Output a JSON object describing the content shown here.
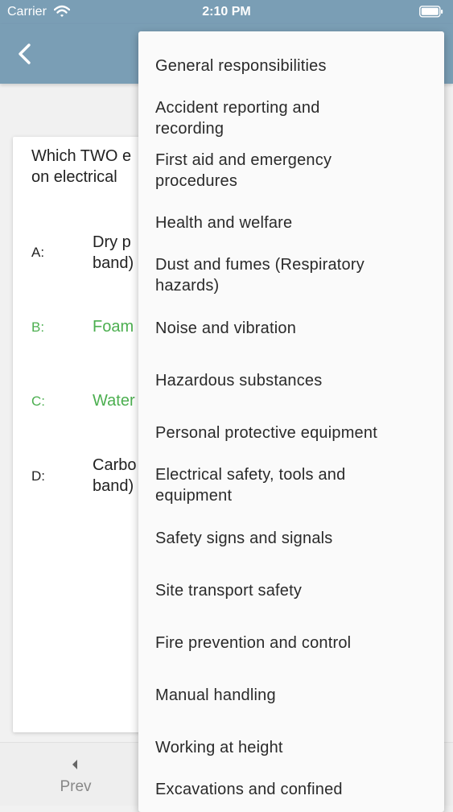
{
  "status_bar": {
    "carrier": "Carrier",
    "time": "2:10 PM"
  },
  "question": {
    "text": "Which TWO e\non electrical"
  },
  "answers": [
    {
      "letter": "A:",
      "text": "Dry p\nband)"
    },
    {
      "letter": "B:",
      "text": "Foam"
    },
    {
      "letter": "C:",
      "text": "Water"
    },
    {
      "letter": "D:",
      "text": "Carbo\nband)"
    }
  ],
  "bottom_bar": {
    "prev_label": "Prev"
  },
  "menu": {
    "items": [
      "General responsibilities",
      "Accident reporting and\nrecording",
      "First aid and emergency\nprocedures",
      "Health and welfare",
      "Dust and fumes (Respiratory\nhazards)",
      "Noise and vibration",
      "Hazardous substances",
      "Personal protective equipment",
      "Electrical safety, tools and\nequipment",
      "Safety signs and signals",
      "Site transport safety",
      "Fire prevention and control",
      "Manual handling",
      "Working at height",
      "Excavations and confined"
    ]
  },
  "colors": {
    "header": "#7a9eb5",
    "correct": "#4caf50"
  },
  "icons": {
    "back": "chevron-left-icon",
    "wifi": "wifi-icon",
    "battery": "battery-icon",
    "prev": "caret-left-icon"
  }
}
